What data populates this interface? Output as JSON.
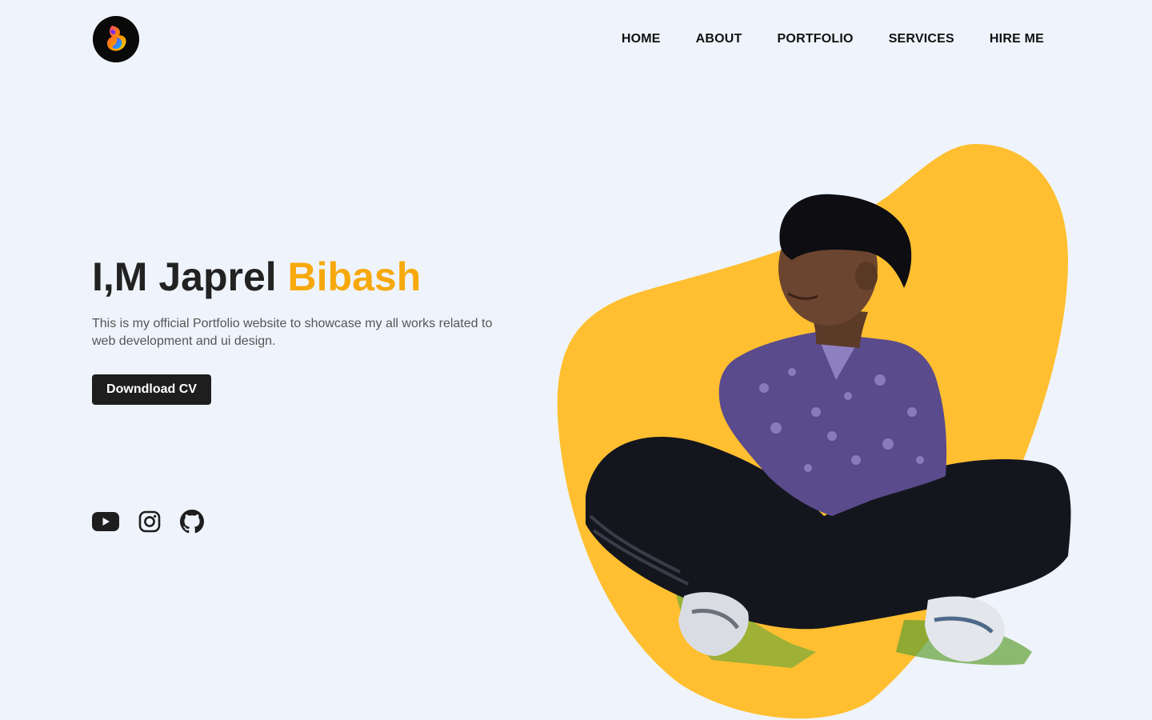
{
  "header": {
    "logo_icon": "flame-b-logo-icon",
    "nav": [
      {
        "label": "HOME"
      },
      {
        "label": "ABOUT"
      },
      {
        "label": "PORTFOLIO"
      },
      {
        "label": "SERVICES"
      },
      {
        "label": "HIRE ME"
      }
    ]
  },
  "hero": {
    "title_prefix": "I,M Japrel",
    "title_accent": "Bibash",
    "description": "This is my official Portfolio website to showcase my all works related to web development and ui design.",
    "cta_label": "Downdload CV",
    "socials": [
      {
        "icon": "youtube-icon"
      },
      {
        "icon": "instagram-icon"
      },
      {
        "icon": "github-icon"
      }
    ],
    "image_icon": "portrait-photo"
  },
  "colors": {
    "background": "#eff4fc",
    "accent": "#f7a90c",
    "blob": "#ffbf30",
    "button": "#1e1e1e",
    "text": "#222222"
  }
}
